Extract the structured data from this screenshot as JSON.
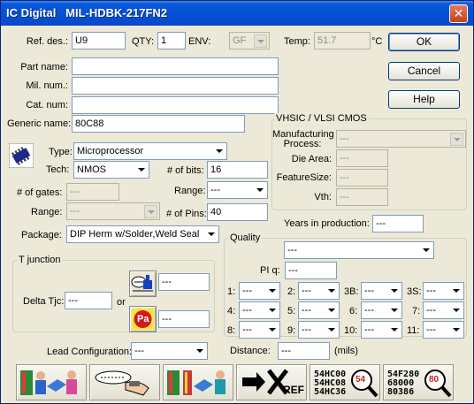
{
  "window": {
    "title": "IC Digital   MIL-HDBK-217FN2",
    "close_glyph": "✕"
  },
  "top": {
    "ref_des_label": "Ref. des.:",
    "ref_des_value": "U9",
    "qty_label": "QTY:",
    "qty_value": "1",
    "env_label": "ENV:",
    "env_value": "GF",
    "temp_label": "Temp:",
    "temp_value": "51.7",
    "temp_unit": "°C"
  },
  "buttons": {
    "ok": "OK",
    "cancel": "Cancel",
    "help": "Help"
  },
  "ident": {
    "part_name_label": "Part name:",
    "part_name_value": "",
    "mil_num_label": "Mil. num.:",
    "mil_num_value": "",
    "cat_num_label": "Cat. num:",
    "cat_num_value": "",
    "generic_name_label": "Generic name:",
    "generic_name_value": "80C88"
  },
  "specs": {
    "type_label": "Type:",
    "type_value": "Microprocessor",
    "tech_label": "Tech:",
    "tech_value": "NMOS",
    "bits_label": "# of bits:",
    "bits_value": "16",
    "gates_label": "# of gates:",
    "gates_value": "---",
    "range_label": "Range:",
    "range_value": "---",
    "range2_label": "Range:",
    "range2_value": "---",
    "pins_label": "# of Pins:",
    "pins_value": "40",
    "package_label": "Package:",
    "package_value": "DIP Herm w/Solder,Weld Seal"
  },
  "vhsic": {
    "title": "VHSIC / VLSI CMOS",
    "mfg_label": "Manufacturing Process:",
    "mfg_value": "---",
    "die_label": "Die Area:",
    "die_value": "---",
    "feature_label": "FeatureSize:",
    "feature_value": "---",
    "vth_label": "Vth:",
    "vth_value": "---"
  },
  "years": {
    "label": "Years in production:",
    "value": "---"
  },
  "quality": {
    "title": "Quality",
    "select_value": "---",
    "piq_label": "PI q:",
    "piq_value": "---",
    "items": [
      {
        "label": "1:",
        "value": "---"
      },
      {
        "label": "2:",
        "value": "---"
      },
      {
        "label": "3B:",
        "value": "---"
      },
      {
        "label": "3S:",
        "value": "---"
      },
      {
        "label": "4:",
        "value": "---"
      },
      {
        "label": "5:",
        "value": "---"
      },
      {
        "label": "6:",
        "value": "---"
      },
      {
        "label": "7:",
        "value": "---"
      },
      {
        "label": "8:",
        "value": "---"
      },
      {
        "label": "9:",
        "value": "---"
      },
      {
        "label": "10:",
        "value": "---"
      },
      {
        "label": "11:",
        "value": "---"
      }
    ]
  },
  "tjunction": {
    "title": "T junction",
    "delta_label": "Delta Tjc:",
    "delta_value": "---",
    "or_label": "or",
    "theta_value": "---",
    "pa_value": "---",
    "pa_icon_text": "Pa"
  },
  "bottom": {
    "lead_label": "Lead Configuration:",
    "lead_value": "---",
    "distance_label": "Distance:",
    "distance_value": "---",
    "distance_unit": "(mils)"
  },
  "toolbar": {
    "xref_text": "REF",
    "search1_lines": [
      "54HC00",
      "54HC08",
      "54HC36"
    ],
    "search1_badge": "54",
    "search2_lines": [
      "54F280",
      "68000",
      "80386"
    ],
    "search2_badge": "80"
  },
  "colors": {
    "title_bar": "#0450d6",
    "window_bg": "#ece9d8",
    "field_border": "#7f9db9"
  }
}
